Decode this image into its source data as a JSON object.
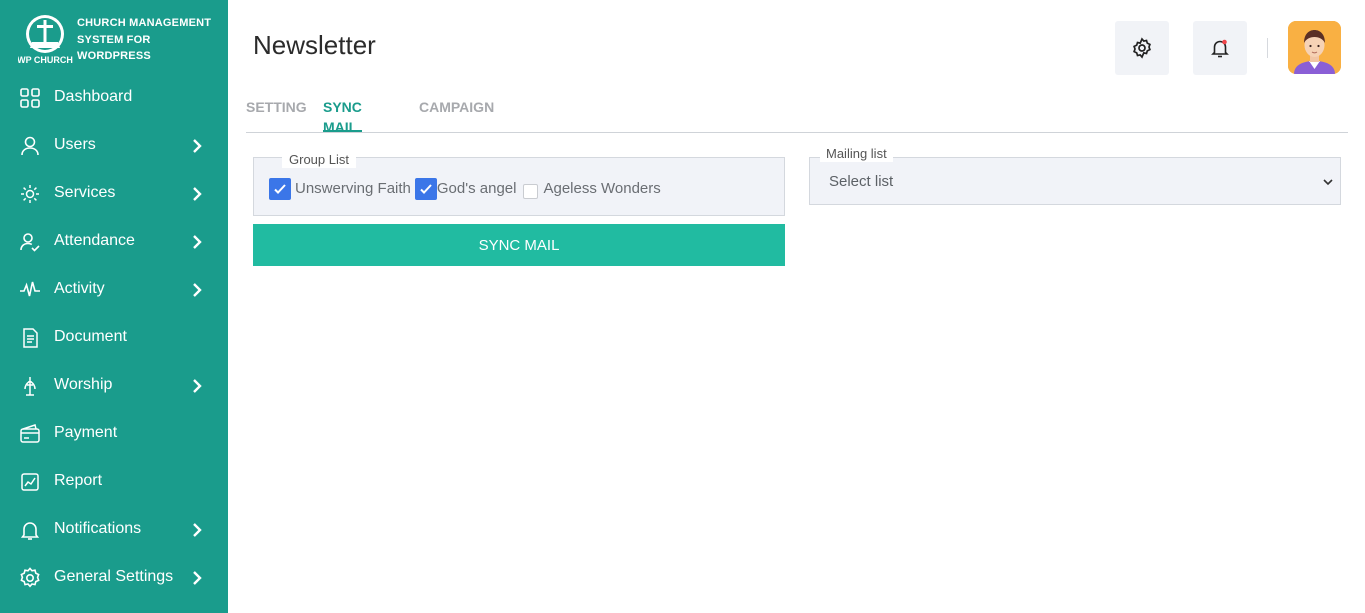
{
  "brand": {
    "logo_text": "WP CHURCH",
    "lines": [
      "CHURCH MANAGEMENT",
      "SYSTEM FOR",
      "WORDPRESS"
    ]
  },
  "nav": [
    {
      "label": "Dashboard",
      "icon": "dashboard-icon",
      "has_chevron": false
    },
    {
      "label": "Users",
      "icon": "user-icon",
      "has_chevron": true
    },
    {
      "label": "Services",
      "icon": "services-icon",
      "has_chevron": true
    },
    {
      "label": "Attendance",
      "icon": "attendance-icon",
      "has_chevron": true
    },
    {
      "label": "Activity",
      "icon": "activity-icon",
      "has_chevron": true
    },
    {
      "label": "Document",
      "icon": "document-icon",
      "has_chevron": false
    },
    {
      "label": "Worship",
      "icon": "worship-icon",
      "has_chevron": true
    },
    {
      "label": "Payment",
      "icon": "payment-icon",
      "has_chevron": false
    },
    {
      "label": "Report",
      "icon": "report-icon",
      "has_chevron": false
    },
    {
      "label": "Notifications",
      "icon": "bell-icon",
      "has_chevron": true
    },
    {
      "label": "General Settings",
      "icon": "gear-icon",
      "has_chevron": true
    }
  ],
  "header": {
    "title": "Newsletter"
  },
  "tabs": [
    {
      "label": "SETTING",
      "active": false
    },
    {
      "label": "SYNC MAIL",
      "active": true
    },
    {
      "label": "CAMPAIGN",
      "active": false
    }
  ],
  "group_list": {
    "legend": "Group List",
    "options": [
      {
        "label": "Unswerving Faith",
        "checked": true
      },
      {
        "label": "God's angel",
        "checked": true
      },
      {
        "label": "Ageless Wonders",
        "checked": false
      }
    ]
  },
  "sync_button": "SYNC MAIL",
  "mailing_list": {
    "legend": "Mailing list",
    "selected": "Select list"
  },
  "colors": {
    "sidebar": "#1a9c8c",
    "accent": "#1a9c8c",
    "button": "#21bba1",
    "checkbox": "#3b76e8",
    "notification_dot": "#f0464b",
    "avatar_bg": "#f9b043"
  }
}
